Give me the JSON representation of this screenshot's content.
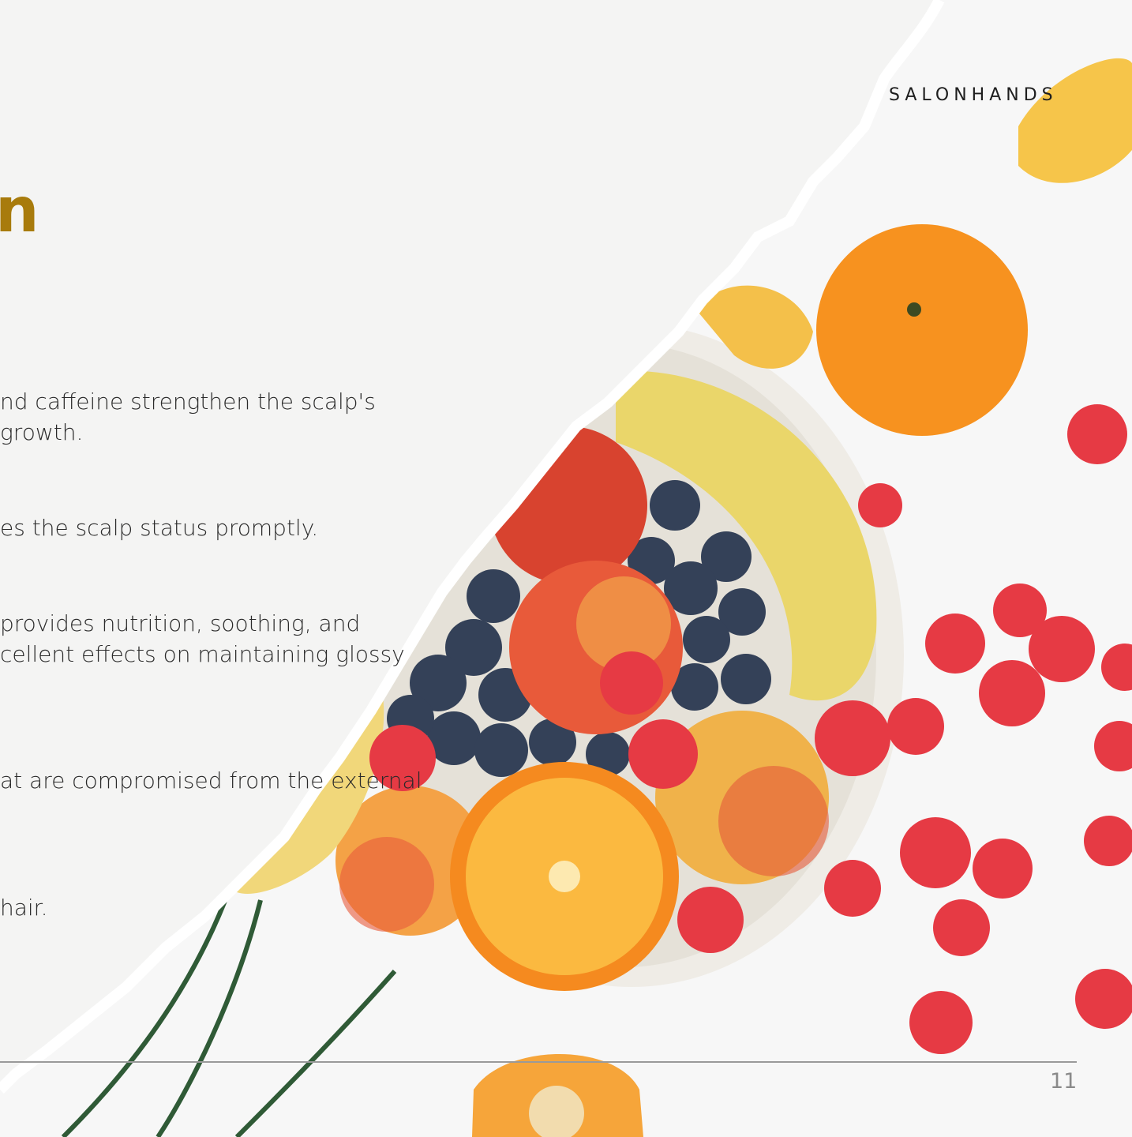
{
  "brand": {
    "name": "SALONHANDS"
  },
  "heading": {
    "fragment": "n"
  },
  "body_lines": [
    "nd caffeine strengthen the scalp's",
    "growth.",
    "es the scalp status promptly.",
    "provides nutrition, soothing, and",
    "cellent effects on maintaining glossy",
    "at are compromised from the external",
    "hair."
  ],
  "footer": {
    "page_number": "11"
  },
  "colors": {
    "heading": "#a87b0c",
    "text": "#2a2a2a",
    "rule": "#9a9a9a"
  }
}
